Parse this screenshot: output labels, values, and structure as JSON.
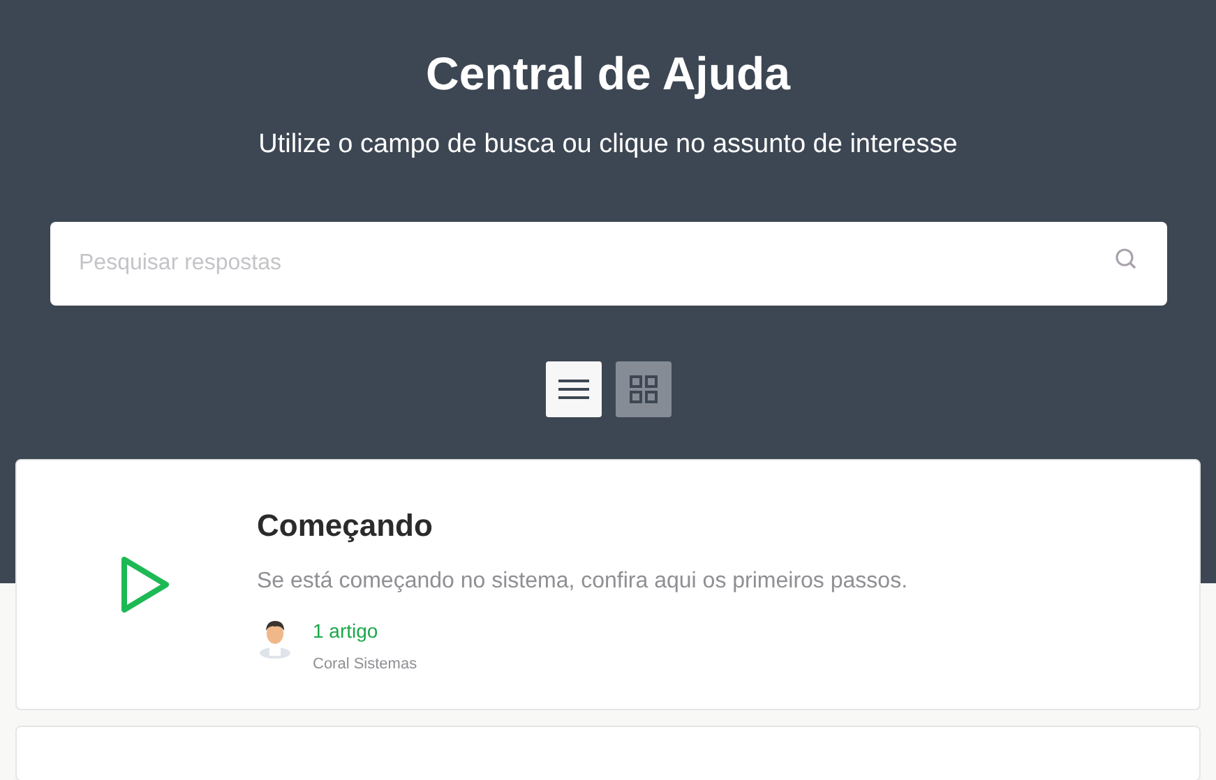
{
  "header": {
    "title": "Central de Ajuda",
    "subtitle": "Utilize o campo de busca ou clique no assunto de interesse"
  },
  "search": {
    "placeholder": "Pesquisar respostas"
  },
  "view_toggle": [
    {
      "kind": "list",
      "selected": true
    },
    {
      "kind": "grid",
      "selected": false
    }
  ],
  "categories": [
    {
      "kind": "play",
      "title": "Começando",
      "description": "Se está começando no sistema, confira aqui os primeiros passos.",
      "count": "1 artigo",
      "author": "Coral Sistemas"
    }
  ]
}
